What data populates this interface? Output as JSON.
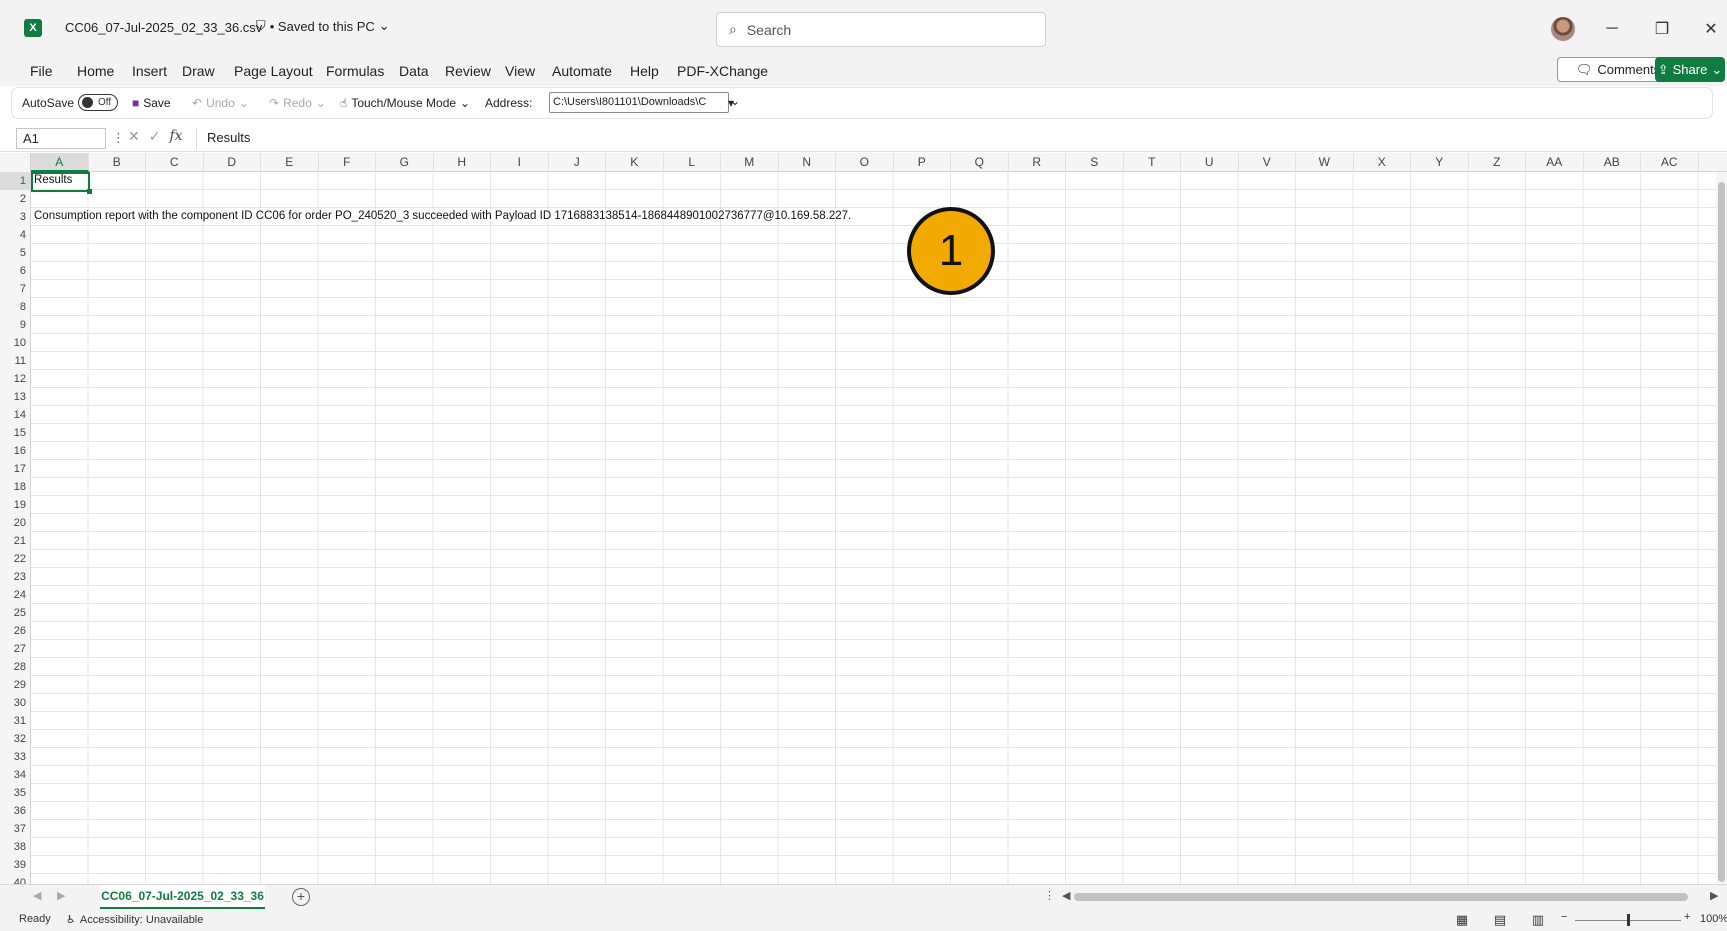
{
  "window": {
    "filename": "CC06_07-Jul-2025_02_33_36.csv",
    "save_status": "• Saved to this PC",
    "app_icon_letter": "X",
    "search_placeholder": "Search",
    "minimize": "─",
    "restore": "❐",
    "close": "✕"
  },
  "ribbon_tabs": [
    "File",
    "Home",
    "Insert",
    "Draw",
    "Page Layout",
    "Formulas",
    "Data",
    "Review",
    "View",
    "Automate",
    "Help",
    "PDF-XChange"
  ],
  "actions": {
    "comments_label": "Comments",
    "share_label": "Share"
  },
  "quick_toolbar": {
    "autosave_label": "AutoSave",
    "autosave_state": "Off",
    "save_label": "Save",
    "undo_label": "Undo",
    "redo_label": "Redo",
    "touch_mode_label": "Touch/Mouse Mode",
    "address_label": "Address:",
    "address_value": "C:\\Users\\I801101\\Downloads\\C"
  },
  "formula_bar": {
    "name_box": "A1",
    "fx_label": "fx",
    "content": "Results"
  },
  "columns": [
    "A",
    "B",
    "C",
    "D",
    "E",
    "F",
    "G",
    "H",
    "I",
    "J",
    "K",
    "L",
    "M",
    "N",
    "O",
    "P",
    "Q",
    "R",
    "S",
    "T",
    "U",
    "V",
    "W",
    "X",
    "Y",
    "Z",
    "AA",
    "AB",
    "AC"
  ],
  "rows": [
    "1",
    "2",
    "3",
    "4",
    "5",
    "6",
    "7",
    "8",
    "9",
    "10",
    "11",
    "12",
    "13",
    "14",
    "15",
    "16",
    "17",
    "18",
    "19",
    "20",
    "21",
    "22",
    "23",
    "24",
    "25",
    "26",
    "27",
    "28",
    "29",
    "30",
    "31",
    "32",
    "33",
    "34",
    "35",
    "36",
    "37",
    "38",
    "39",
    "40"
  ],
  "cells": {
    "A1": "Results",
    "A3": "Consumption report with the component ID CC06 for order PO_240520_3 succeeded with Payload ID 1716883138514-1868448901002736777@10.169.58.227."
  },
  "annotation_badge": "1",
  "sheet": {
    "active_tab": "CC06_07-Jul-2025_02_33_36",
    "add_sheet": "+"
  },
  "status": {
    "ready": "Ready",
    "accessibility": "Accessibility: Unavailable",
    "zoom": "100%"
  },
  "colors": {
    "excel_green": "#107c41",
    "badge_fill": "#f2a900"
  }
}
